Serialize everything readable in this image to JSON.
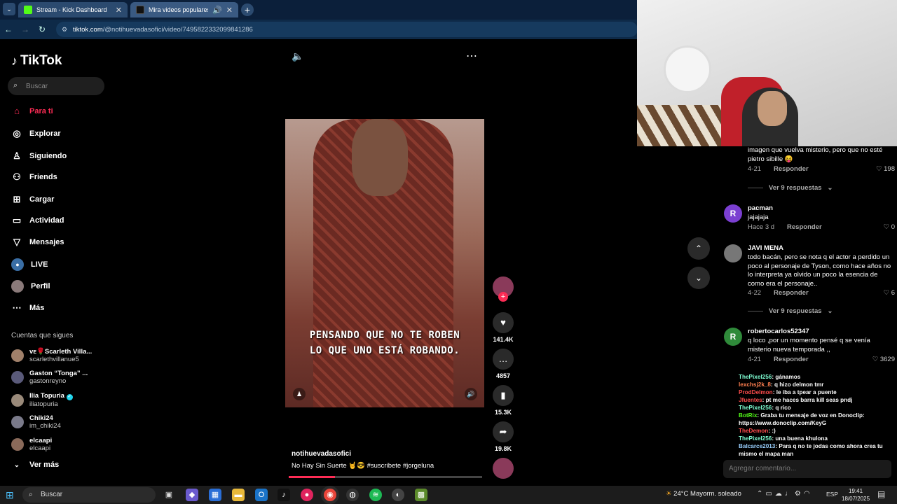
{
  "browser": {
    "tabs": [
      {
        "title": "Stream - Kick Dashboard",
        "icon": "kick-icon",
        "color": "#53fc18"
      },
      {
        "title": "Mira videos populares sele",
        "icon": "tiktok-icon",
        "color": "#000000"
      }
    ],
    "url_host": "tiktok.com",
    "url_path": "/@notihuevadasofici/video/7495822332099841286"
  },
  "sidebar": {
    "logo": "TikTok",
    "search_placeholder": "Buscar",
    "nav": [
      {
        "label": "Para ti",
        "icon": "home-icon",
        "active": true
      },
      {
        "label": "Explorar",
        "icon": "compass-icon"
      },
      {
        "label": "Siguiendo",
        "icon": "following-icon"
      },
      {
        "label": "Friends",
        "icon": "friends-icon"
      },
      {
        "label": "Cargar",
        "icon": "upload-icon"
      },
      {
        "label": "Actividad",
        "icon": "activity-icon"
      },
      {
        "label": "Mensajes",
        "icon": "messages-icon"
      },
      {
        "label": "LIVE",
        "icon": "live-icon"
      },
      {
        "label": "Perfil",
        "icon": "profile-icon"
      },
      {
        "label": "Más",
        "icon": "more-icon"
      }
    ],
    "following_header": "Cuentas que sigues",
    "accounts": [
      {
        "name": "ᴠᴇ🌹Scarleth Villa...",
        "handle": "scarlethvillanue5"
      },
      {
        "name": "Gaston “Tonga” ...",
        "handle": "gastonreyno"
      },
      {
        "name": "Ilia Topuria",
        "handle": "iliatopuria"
      },
      {
        "name": "Chiki24",
        "handle": "im_chiki24"
      },
      {
        "name": "elcaapi",
        "handle": "elcaapi"
      }
    ],
    "see_more": "Ver más"
  },
  "video": {
    "caption_line1": "PENSANDO QUE NO TE ROBEN",
    "caption_line2": "LO QUE UNO ESTÁ ROBANDO.",
    "author": "notihuevadasofici",
    "description": "No Hay Sin Suerte 🤘😎 #suscribete  #jorgeluna",
    "likes": "141.4K",
    "comments": "4857",
    "saves": "15.3K",
    "shares": "19.8K",
    "progress": 0.24
  },
  "comments": [
    {
      "text": "imagen que vuelva misterio, pero que no esté pietro sibille 😝",
      "date": "4-21",
      "reply": "Responder",
      "likes": "198"
    },
    {
      "more": "Ver 9 respuestas"
    },
    {
      "initial": "R",
      "color": "#7b3fd1",
      "user": "pacman",
      "text": "jajajaja",
      "date": "Hace 3 d",
      "reply": "Responder",
      "likes": "0"
    },
    {
      "user": "JAVI MENA",
      "text": "todo bacán, pero se nota q el actor a perdido un poco al personaje de Tyson, como hace años no lo interpreta ya olvido un poco la esencia de como era el personaje..",
      "date": "4-22",
      "reply": "Responder",
      "likes": "6"
    },
    {
      "more": "Ver 9 respuestas"
    },
    {
      "initial": "R",
      "color": "#2f8a3a",
      "user": "robertocarlos52347",
      "text": "q loco ,por un momento pensé q se venía misterio nueva temporada ,,",
      "date": "4-21",
      "reply": "Responder",
      "likes": "3629"
    }
  ],
  "chat": [
    {
      "user": "ThePixel256",
      "msg": ": gánamos",
      "color": "#7fffd4"
    },
    {
      "user": "lexchsj2k_8",
      "msg": ": q hizo delmon tmr",
      "color": "#ff7f50"
    },
    {
      "user": "ProdDelmon",
      "msg": ": le iba a tpear a puente",
      "color": "#ff4d4d"
    },
    {
      "user": "Jfuentes",
      "msg": ": pt me haces barra kill seas pndj",
      "color": "#ff4d4d"
    },
    {
      "user": "ThePixel256",
      "msg": ": q rico",
      "color": "#7fffd4"
    },
    {
      "user": "BotRix",
      "msg": ": Graba tu mensaje de voz en Donoclip: https://www.donoclip.com/KeyG",
      "color": "#53fc18"
    },
    {
      "user": "TheDemon",
      "msg": ": :)",
      "color": "#ff4d4d"
    },
    {
      "user": "ThePixel256",
      "msg": ": una buena khulona",
      "color": "#7fffd4"
    },
    {
      "user": "Balcarce2013",
      "msg": ": Para q no te jodas como ahora crea tu mismo el mapa man",
      "color": "#9ad1ff"
    }
  ],
  "add_comment_placeholder": "Agregar comentario...",
  "taskbar": {
    "search": "Buscar",
    "weather_temp": "24°C",
    "weather_desc": "Mayorm. soleado",
    "lang": "ESP",
    "time": "19:41",
    "date": "18/07/2025"
  }
}
